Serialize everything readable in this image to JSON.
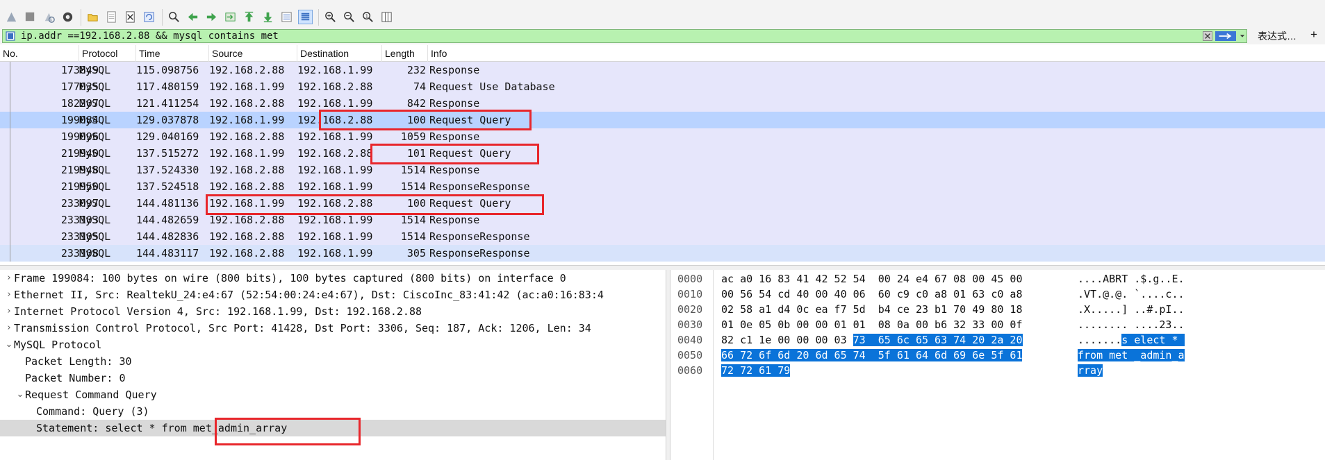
{
  "filter": {
    "text": "ip.addr ==192.168.2.88 && mysql contains met",
    "expression_label": "表达式…",
    "plus_label": "+"
  },
  "toolbar_icons": [
    "shark-fin-start-icon",
    "stop-capture-icon",
    "restart-capture-icon",
    "capture-options-icon",
    "open-file-icon",
    "save-file-icon",
    "close-file-icon",
    "reload-file-icon",
    "find-packet-icon",
    "go-back-icon",
    "go-forward-icon",
    "go-to-packet-icon",
    "go-first-icon",
    "go-last-icon",
    "autoscroll-icon",
    "colorize-icon",
    "zoom-in-icon",
    "zoom-out-icon",
    "zoom-normal-icon",
    "resize-columns-icon"
  ],
  "columns": {
    "no": "No.",
    "protocol": "Protocol",
    "time": "Time",
    "source": "Source",
    "destination": "Destination",
    "length": "Length",
    "info": "Info"
  },
  "packets": [
    {
      "no": "173849",
      "protocol": "MySQL",
      "time": "115.098756",
      "source": "192.168.2.88",
      "destination": "192.168.1.99",
      "length": "232",
      "info": "Response"
    },
    {
      "no": "177035",
      "protocol": "MySQL",
      "time": "117.480159",
      "source": "192.168.1.99",
      "destination": "192.168.2.88",
      "length": "74",
      "info": "Request Use Database"
    },
    {
      "no": "182207",
      "protocol": "MySQL",
      "time": "121.411254",
      "source": "192.168.2.88",
      "destination": "192.168.1.99",
      "length": "842",
      "info": "Response"
    },
    {
      "no": "199084",
      "protocol": "MySQL",
      "time": "129.037878",
      "source": "192.168.1.99",
      "destination": "192.168.2.88",
      "length": "100",
      "info": "Request Query"
    },
    {
      "no": "199096",
      "protocol": "MySQL",
      "time": "129.040169",
      "source": "192.168.2.88",
      "destination": "192.168.1.99",
      "length": "1059",
      "info": "Response"
    },
    {
      "no": "219940",
      "protocol": "MySQL",
      "time": "137.515272",
      "source": "192.168.1.99",
      "destination": "192.168.2.88",
      "length": "101",
      "info": "Request Query"
    },
    {
      "no": "219948",
      "protocol": "MySQL",
      "time": "137.524330",
      "source": "192.168.2.88",
      "destination": "192.168.1.99",
      "length": "1514",
      "info": "Response"
    },
    {
      "no": "219950",
      "protocol": "MySQL",
      "time": "137.524518",
      "source": "192.168.2.88",
      "destination": "192.168.1.99",
      "length": "1514",
      "info": "ResponseResponse"
    },
    {
      "no": "233097",
      "protocol": "MySQL",
      "time": "144.481136",
      "source": "192.168.1.99",
      "destination": "192.168.2.88",
      "length": "100",
      "info": "Request Query"
    },
    {
      "no": "233103",
      "protocol": "MySQL",
      "time": "144.482659",
      "source": "192.168.2.88",
      "destination": "192.168.1.99",
      "length": "1514",
      "info": "Response"
    },
    {
      "no": "233105",
      "protocol": "MySQL",
      "time": "144.482836",
      "source": "192.168.2.88",
      "destination": "192.168.1.99",
      "length": "1514",
      "info": "ResponseResponse"
    },
    {
      "no": "233108",
      "protocol": "MySQL",
      "time": "144.483117",
      "source": "192.168.2.88",
      "destination": "192.168.1.99",
      "length": "305",
      "info": "ResponseResponse"
    }
  ],
  "selected_packet_index": 3,
  "details": [
    {
      "text": "Frame 199084: 100 bytes on wire (800 bits), 100 bytes captured (800 bits) on interface 0",
      "level": 0,
      "expander": "collapsed"
    },
    {
      "text": "Ethernet II, Src: RealtekU_24:e4:67 (52:54:00:24:e4:67), Dst: CiscoInc_83:41:42 (ac:a0:16:83:4",
      "level": 0,
      "expander": "collapsed"
    },
    {
      "text": "Internet Protocol Version 4, Src: 192.168.1.99, Dst: 192.168.2.88",
      "level": 0,
      "expander": "collapsed"
    },
    {
      "text": "Transmission Control Protocol, Src Port: 41428, Dst Port: 3306, Seq: 187, Ack: 1206, Len: 34",
      "level": 0,
      "expander": "collapsed"
    },
    {
      "text": "MySQL Protocol",
      "level": 0,
      "expander": "expanded"
    },
    {
      "text": "Packet Length: 30",
      "level": 1,
      "expander": "none"
    },
    {
      "text": "Packet Number: 0",
      "level": 1,
      "expander": "none"
    },
    {
      "text": "Request Command Query",
      "level": 1,
      "expander": "expanded"
    },
    {
      "text": "Command: Query (3)",
      "level": 2,
      "expander": "none"
    },
    {
      "text": "Statement: select * from met_admin_array",
      "level": 2,
      "expander": "none"
    }
  ],
  "selected_detail_index": 9,
  "bytes": [
    {
      "offset": "0000",
      "hex_plain": "ac a0 16 83 41 42 52 54  00 24 e4 67 08 00 45 00",
      "hex_hl": "",
      "ascii_plain": "....ABRT .$.g..E.",
      "ascii_hl": ""
    },
    {
      "offset": "0010",
      "hex_plain": "00 56 54 cd 40 00 40 06  60 c9 c0 a8 01 63 c0 a8",
      "hex_hl": "",
      "ascii_plain": ".VT.@.@. `....c..",
      "ascii_hl": ""
    },
    {
      "offset": "0020",
      "hex_plain": "02 58 a1 d4 0c ea f7 5d  b4 ce 23 b1 70 49 80 18",
      "hex_hl": "",
      "ascii_plain": ".X.....] ..#.pI..",
      "ascii_hl": ""
    },
    {
      "offset": "0030",
      "hex_plain": "01 0e 05 0b 00 00 01 01  08 0a 00 b6 32 33 00 0f",
      "hex_hl": "",
      "ascii_plain": "........ ....23..",
      "ascii_hl": ""
    },
    {
      "offset": "0040",
      "hex_plain": "82 c1 1e 00 00 00 03 ",
      "hex_hl": "73  65 6c 65 63 74 20 2a 20",
      "ascii_plain": ".......",
      "ascii_hl": "s elect * "
    },
    {
      "offset": "0050",
      "hex_plain": "",
      "hex_hl": "66 72 6f 6d 20 6d 65 74  5f 61 64 6d 69 6e 5f 61",
      "ascii_plain": "",
      "ascii_hl": "from met _admin_a"
    },
    {
      "offset": "0060",
      "hex_plain": "",
      "hex_hl": "72 72 61 79",
      "ascii_plain": "",
      "ascii_hl": "rray"
    }
  ],
  "colors": {
    "filter_bg": "#b8f1b0",
    "row_bg": "#e6e6fb",
    "row_selected": "#b9d3ff",
    "byte_highlight": "#0a73d9",
    "annotation_red": "#e8262b"
  }
}
